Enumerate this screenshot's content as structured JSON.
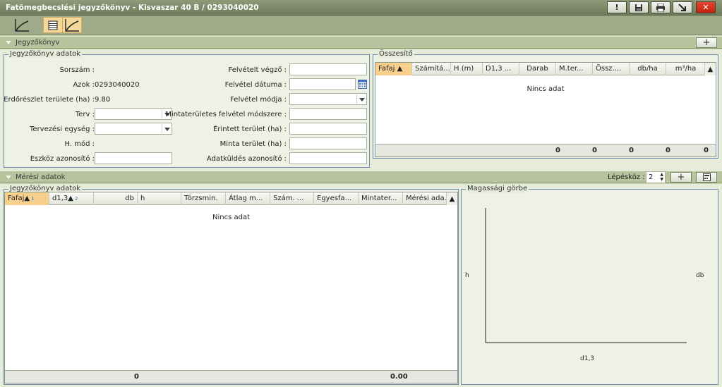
{
  "window": {
    "title": "Fatömegbecslési jegyzőkönyv - Kisvaszar 40 B / 0293040020",
    "buttons": {
      "alert": "!",
      "close": "✕"
    }
  },
  "sections": {
    "jegyzokonyv": "Jegyzőkönyv",
    "meresi": "Mérési adatok"
  },
  "jegyzokonyv_adatok": {
    "label": "Jegyzőkönyv adatok",
    "sorszam_label": "Sorszám :",
    "sorszam_value": "",
    "azok_label": "Azok :",
    "azok_value": "0293040020",
    "terulet_label": "Erdőrészlet területe (ha) :",
    "terulet_value": "9.80",
    "terv_label": "Terv :",
    "tervezesi_label": "Tervezési egység :",
    "hmod_label": "H. mód :",
    "hmod_value": "",
    "eszkoz_label": "Eszköz azonosító :",
    "felvetelt_vegzo_label": "Felvételt végző :",
    "felvetel_datuma_label": "Felvétel dátuma :",
    "felvetel_modja_label": "Felvétel módja :",
    "mintateruletes_label": "Mintaterületes felvétel módszere :",
    "erintett_label": "Érintett terület (ha) :",
    "minta_terulet_label": "Minta terület (ha) :",
    "adatkuldes_label": "Adatküldés azonosító :"
  },
  "osszesito": {
    "label": "Összesítő",
    "columns": [
      "Fafaj",
      "Számítá...",
      "H (m)",
      "D1,3 ...",
      "Darab",
      "M.ter...",
      "Össz....",
      "db/ha",
      "m³/ha"
    ],
    "no_data": "Nincs adat",
    "footer": [
      "0",
      "0",
      "0",
      "0",
      "0"
    ]
  },
  "meresi": {
    "label": "Jegyzőkönyv adatok",
    "lepeskoz_label": "Lépésköz :",
    "lepeskoz_value": "2",
    "columns": [
      "Fafaj",
      "d1,3",
      "db",
      "h",
      "Törzsmin.",
      "Átlag m...",
      "Szám. ...",
      "Egyesfa...",
      "Mintater...",
      "Mérési ada..."
    ],
    "sort_marks": [
      "1",
      "2"
    ],
    "no_data": "Nincs adat",
    "footer": [
      "0",
      "0.00"
    ]
  },
  "chart": {
    "label": "Magassági görbe",
    "ylabel": "h",
    "y2label": "db",
    "xlabel": "d1,3"
  }
}
